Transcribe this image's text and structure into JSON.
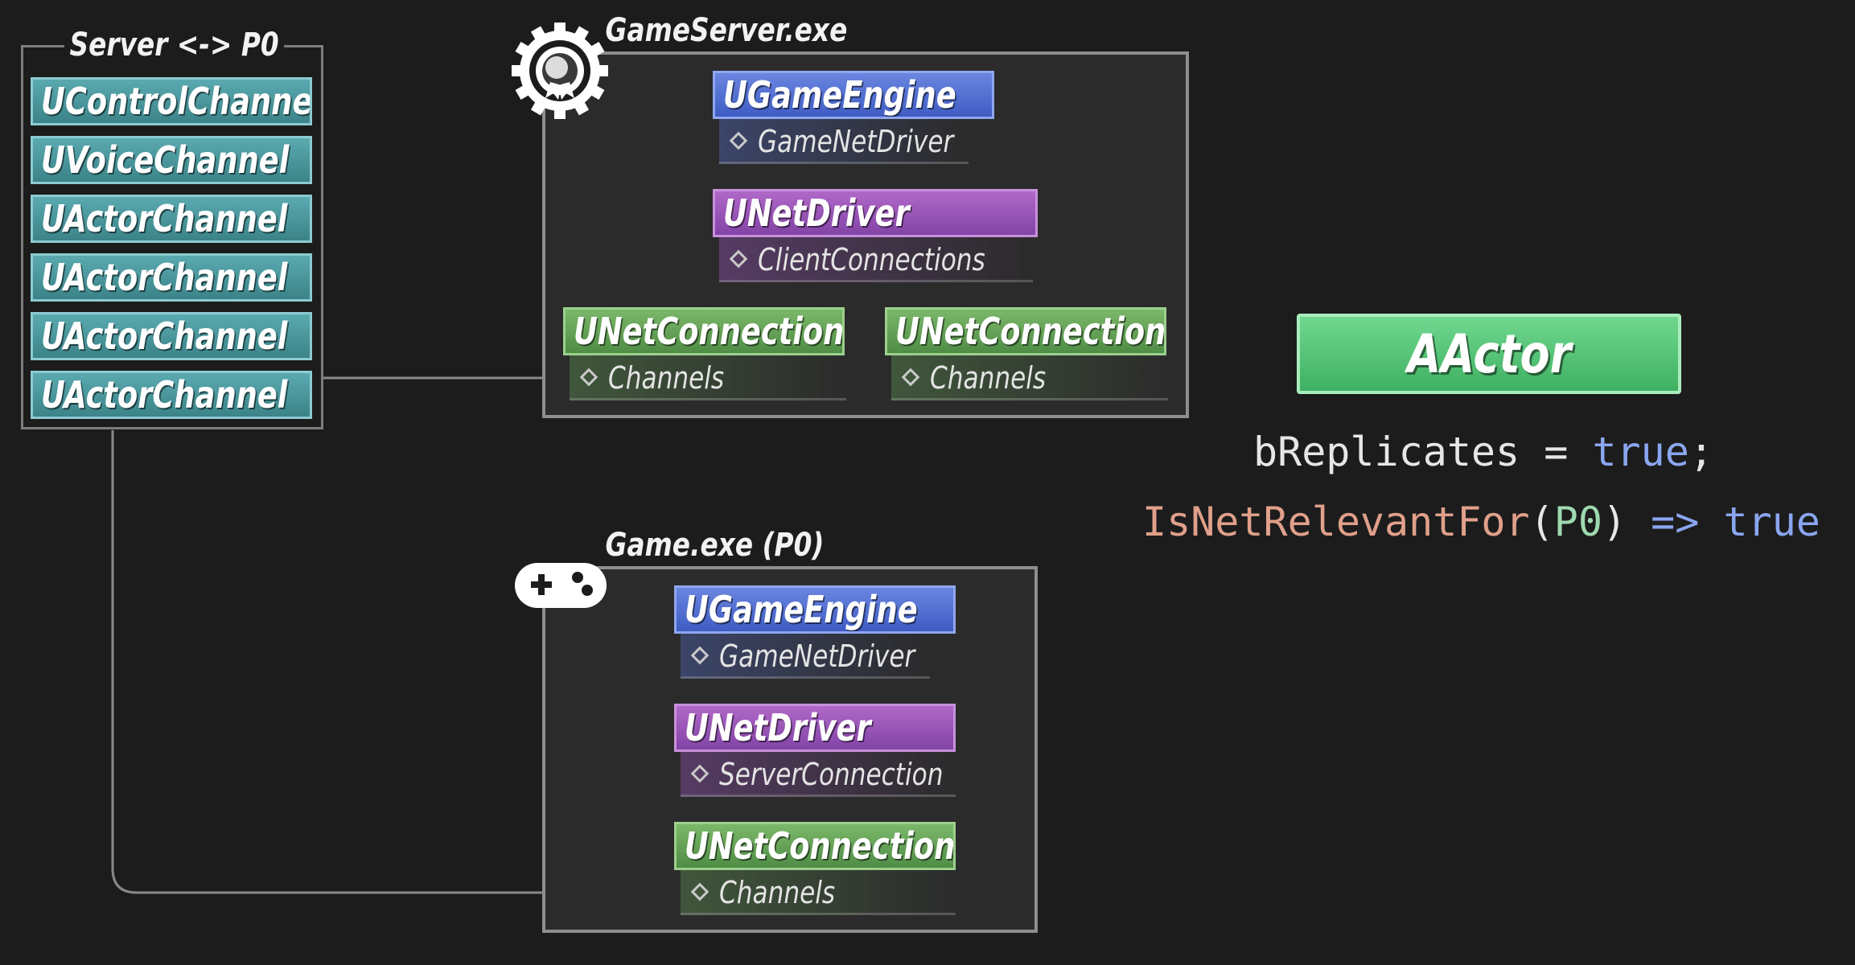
{
  "channels_box": {
    "title": "Server <-> P0",
    "items": [
      "UControlChannel",
      "UVoiceChannel",
      "UActorChannel",
      "UActorChannel",
      "UActorChannel",
      "UActorChannel"
    ]
  },
  "server": {
    "title": "GameServer.exe",
    "icon": "award-medal-icon",
    "engine": {
      "label": "UGameEngine",
      "prop": "GameNetDriver"
    },
    "driver": {
      "label": "UNetDriver",
      "prop": "ClientConnections"
    },
    "connections": [
      {
        "label": "UNetConnection",
        "prop": "Channels"
      },
      {
        "label": "UNetConnection",
        "prop": "Channels"
      }
    ]
  },
  "client": {
    "title": "Game.exe (P0)",
    "icon": "gamepad-icon",
    "engine": {
      "label": "UGameEngine",
      "prop": "GameNetDriver"
    },
    "driver": {
      "label": "UNetDriver",
      "prop": "ServerConnection"
    },
    "connection": {
      "label": "UNetConnection",
      "prop": "Channels"
    }
  },
  "actor": {
    "label": "AActor",
    "line1": {
      "lhs": "bReplicates",
      "op": " = ",
      "value": "true",
      "end": ";"
    },
    "line2": {
      "fn": "IsNetRelevantFor",
      "open": "(",
      "arg": "P0",
      "close": ")",
      "arrow": " => ",
      "result": "true"
    }
  },
  "colors": {
    "engine": "#4f6fd0",
    "driver": "#9a56b8",
    "connection": "#5f9f52",
    "channel": "#4a979c",
    "actor": "#4fc474",
    "background": "#1c1c1c"
  }
}
